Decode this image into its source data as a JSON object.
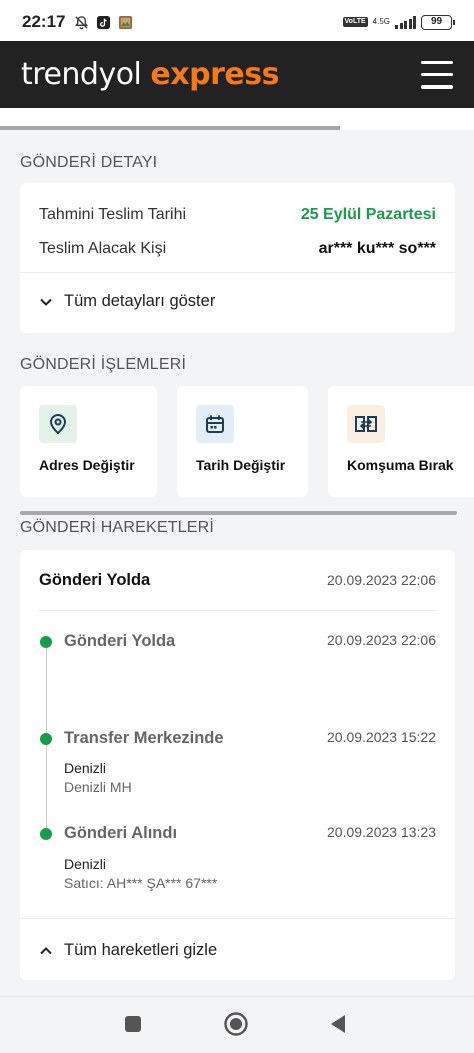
{
  "status_bar": {
    "time": "22:17",
    "network": "4.5G",
    "volte": "VoLTE",
    "battery": "99",
    "icons": [
      "mute-icon",
      "tiktok-icon",
      "gallery-icon",
      "signal-icon",
      "battery-icon"
    ]
  },
  "header": {
    "logo_part1": "trendyol",
    "logo_part2": "express",
    "brand_color": "#f27a1a",
    "menu_icon": "hamburger-icon"
  },
  "detail": {
    "section_title": "GÖNDERİ DETAYI",
    "rows": [
      {
        "label": "Tahmini Teslim Tarihi",
        "value": "25 Eylül Pazartesi"
      },
      {
        "label": "Teslim Alacak Kişi",
        "value": "ar*** ku*** so***"
      }
    ],
    "toggle_label": "Tüm detayları göster"
  },
  "actions": {
    "section_title": "GÖNDERİ İŞLEMLERİ",
    "items": [
      {
        "label": "Adres Değiştir",
        "icon": "location-pin-icon"
      },
      {
        "label": "Tarih Değiştir",
        "icon": "calendar-icon"
      },
      {
        "label": "Komşuma Bırak",
        "icon": "transfer-icon"
      }
    ]
  },
  "movements": {
    "section_title": "GÖNDERİ HAREKETLERİ",
    "current_status": "Gönderi Yolda",
    "current_date": "20.09.2023 22:06",
    "timeline": [
      {
        "title": "Gönderi Yolda",
        "date": "20.09.2023 22:06",
        "line1": "",
        "line2": ""
      },
      {
        "title": "Transfer Merkezinde",
        "date": "20.09.2023 15:22",
        "line1": "Denizli",
        "line2": "Denizli MH"
      },
      {
        "title": "Gönderi Alındı",
        "date": "20.09.2023 13:23",
        "line1": "Denizli",
        "line2": "Satıcı: AH*** ŞA*** 67***"
      }
    ],
    "toggle_label": "Tüm hareketleri gizle"
  },
  "nav": {
    "icons": [
      "recent-apps-icon",
      "home-icon",
      "back-icon"
    ]
  }
}
